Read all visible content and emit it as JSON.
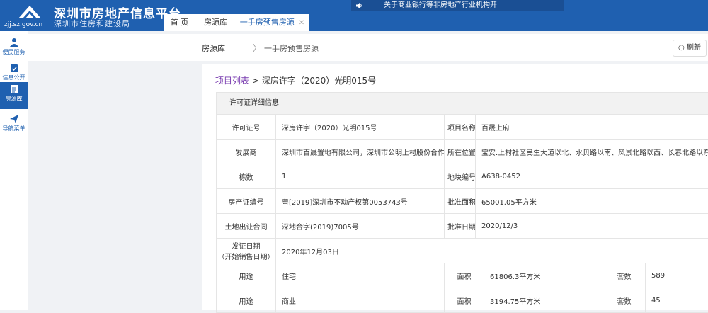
{
  "header": {
    "logo_domain": "zjj.sz.gov.cn",
    "title": "深圳市房地产信息平台",
    "subtitle": "深圳市住房和建设局",
    "notice": "关于商业银行等非房地产行业机构开",
    "brand_color": "#1f60b0"
  },
  "tabs": [
    {
      "label": "首 页",
      "active": false
    },
    {
      "label": "房源库",
      "active": false
    },
    {
      "label": "一手房预售房源",
      "active": true,
      "closable": true
    }
  ],
  "sidebar": {
    "items": [
      {
        "label": "便民服务",
        "icon": "people-icon",
        "active": false
      },
      {
        "label": "信息公开",
        "icon": "clipboard-icon",
        "active": false
      },
      {
        "label": "房源库",
        "icon": "document-icon",
        "active": true
      },
      {
        "label": "导航菜单",
        "icon": "send-icon",
        "active": false
      }
    ]
  },
  "breadcrumb": {
    "root": "房源库",
    "separator": "〉",
    "current": "一手房预售房源",
    "refresh_label": "刷新"
  },
  "project": {
    "list_link": "项目列表",
    "separator": " > ",
    "permit": "深房许字（2020）光明015号"
  },
  "detail": {
    "heading": "许可证详细信息",
    "rows": [
      {
        "l1": "许可证号",
        "v1": "深房许字（2020）光明015号",
        "l2": "项目名称",
        "v2": "百晟上府"
      },
      {
        "l1": "发展商",
        "v1": "深圳市百晟置地有限公司，深圳市公明上村股份合作公司",
        "l2": "所在位置",
        "v2": "宝安.上村社区民生大道以北、水贝路以南、风景北路以西、长春北路以东"
      },
      {
        "l1": "栋数",
        "v1": "1",
        "l2": "地块编号",
        "v2": "A638-0452"
      },
      {
        "l1": "房产证编号",
        "v1": "粤[2019]深圳市不动产权第0053743号",
        "l2": "批准面积",
        "v2": "65001.05平方米"
      },
      {
        "l1": "土地出让合同",
        "v1": "深地合字(2019)7005号",
        "l2": "批准日期",
        "v2": "2020/12/3"
      }
    ],
    "issue_label_line1": "发证日期",
    "issue_label_line2": "（开始销售日期）",
    "issue_value": "2020年12月03日",
    "usage_rows": [
      {
        "usage_label": "用途",
        "usage": "住宅",
        "area_label": "面积",
        "area": "61806.3平方米",
        "count_label": "套数",
        "count": "589"
      },
      {
        "usage_label": "用途",
        "usage": "商业",
        "area_label": "面积",
        "area": "3194.75平方米",
        "count_label": "套数",
        "count": "45"
      }
    ]
  }
}
